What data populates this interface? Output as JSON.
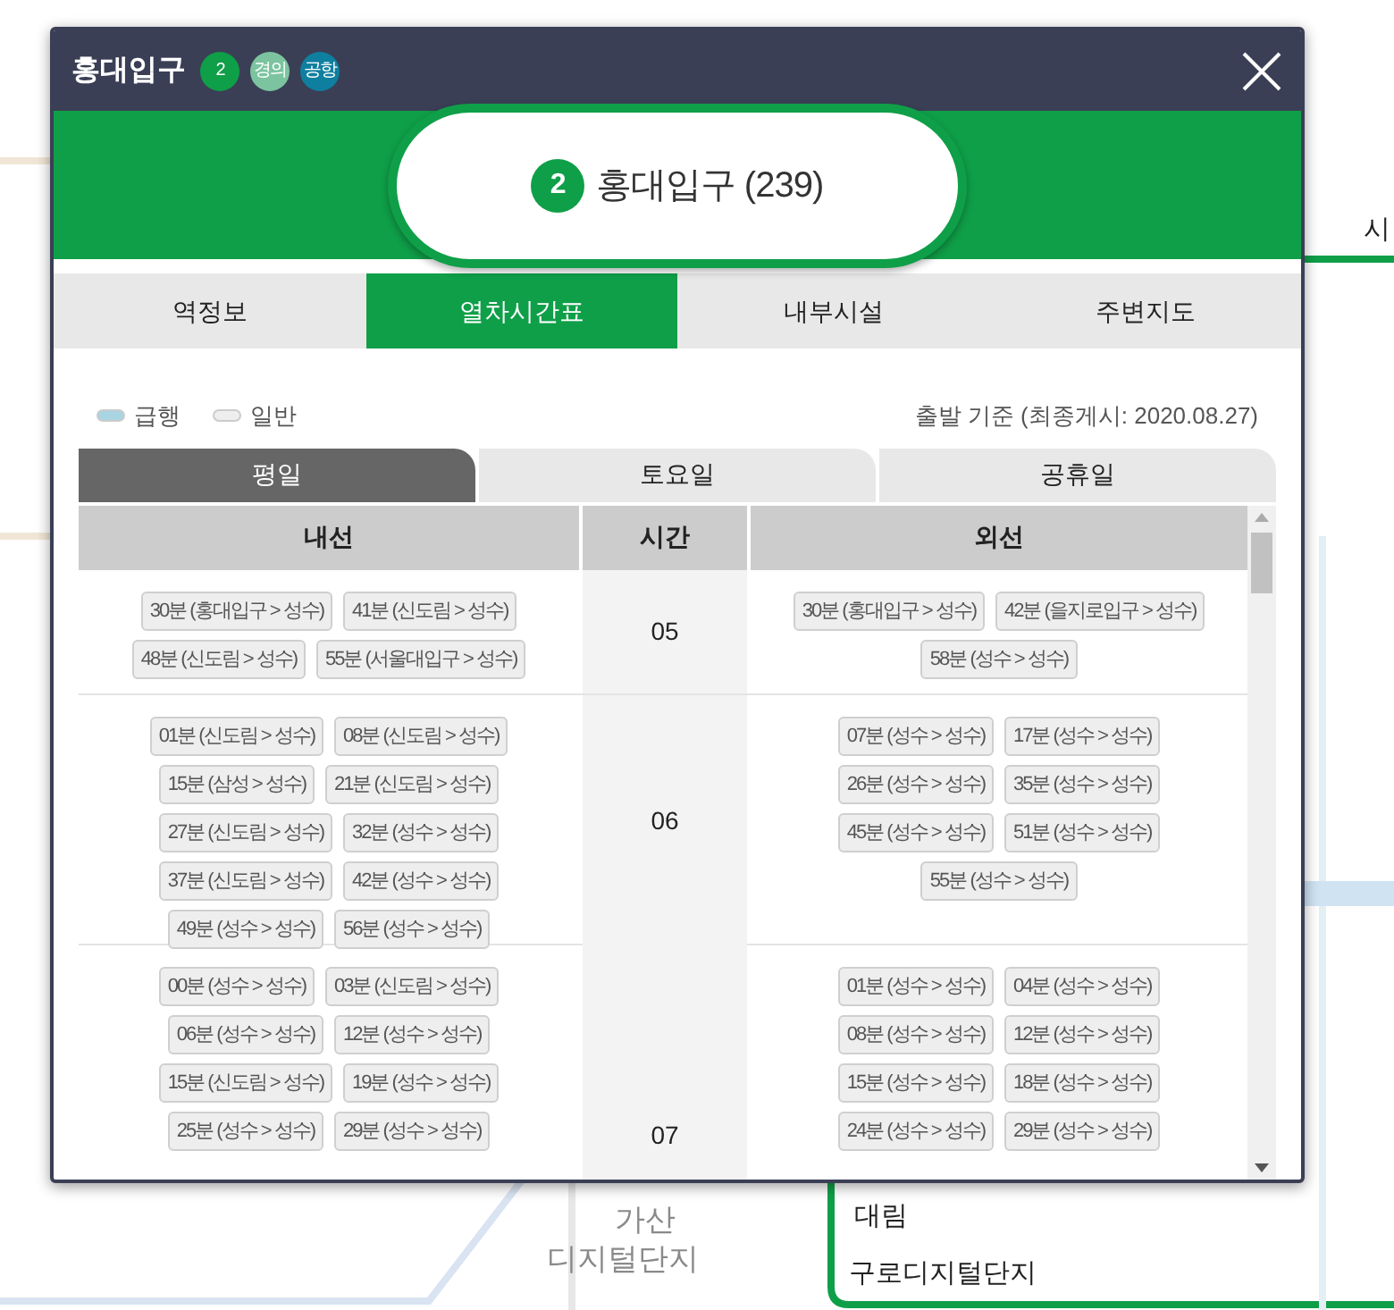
{
  "map_labels": [
    {
      "text": "시",
      "kind": "strong"
    },
    {
      "text": "가산",
      "kind": "faded"
    },
    {
      "text": "디지털단지",
      "kind": "faded"
    },
    {
      "text": "대림",
      "kind": "strong"
    },
    {
      "text": "구로디지털단지",
      "kind": "strong"
    }
  ],
  "window": {
    "title": "홍대입구",
    "line_badges": [
      {
        "text": "2",
        "color": "#0f9f48"
      },
      {
        "text": "경의",
        "color": "#7cc4a0"
      },
      {
        "text": "공항",
        "color": "#0f7fa0"
      }
    ]
  },
  "station": {
    "line": "2",
    "name": "홍대입구 (239)"
  },
  "tabs": [
    {
      "label": "역정보",
      "selected": false
    },
    {
      "label": "열차시간표",
      "selected": true
    },
    {
      "label": "내부시설",
      "selected": false
    },
    {
      "label": "주변지도",
      "selected": false
    }
  ],
  "legend": [
    {
      "label": "급행",
      "color": "#a9d4e2"
    },
    {
      "label": "일반",
      "color": "#eeeeee"
    }
  ],
  "basis": "출발 기준 (최종게시: 2020.08.27)",
  "day_tabs": [
    {
      "label": "평일",
      "selected": true
    },
    {
      "label": "토요일",
      "selected": false
    },
    {
      "label": "공휴일",
      "selected": false
    }
  ],
  "table": {
    "columns": [
      "내선",
      "시간",
      "외선"
    ],
    "rows": [
      {
        "hour": "05",
        "inner": [
          "30분 (홍대입구 > 성수)",
          "41분 (신도림 > 성수)",
          "48분 (신도림 > 성수)",
          "55분 (서울대입구 > 성수)"
        ],
        "outer": [
          "30분 (홍대입구 > 성수)",
          "42분 (을지로입구 > 성수)",
          "58분 (성수 > 성수)"
        ]
      },
      {
        "hour": "06",
        "inner": [
          "01분 (신도림 > 성수)",
          "08분 (신도림 > 성수)",
          "15분 (삼성 > 성수)",
          "21분 (신도림 > 성수)",
          "27분 (신도림 > 성수)",
          "32분 (성수 > 성수)",
          "37분 (신도림 > 성수)",
          "42분 (성수 > 성수)",
          "49분 (성수 > 성수)",
          "56분 (성수 > 성수)"
        ],
        "outer": [
          "07분 (성수 > 성수)",
          "17분 (성수 > 성수)",
          "26분 (성수 > 성수)",
          "35분 (성수 > 성수)",
          "45분 (성수 > 성수)",
          "51분 (성수 > 성수)",
          "55분 (성수 > 성수)"
        ]
      },
      {
        "hour": "07",
        "inner": [
          "00분 (성수 > 성수)",
          "03분 (신도림 > 성수)",
          "06분 (성수 > 성수)",
          "12분 (성수 > 성수)",
          "15분 (신도림 > 성수)",
          "19분 (성수 > 성수)",
          "25분 (성수 > 성수)",
          "29분 (성수 > 성수)"
        ],
        "outer": [
          "01분 (성수 > 성수)",
          "04분 (성수 > 성수)",
          "08분 (성수 > 성수)",
          "12분 (성수 > 성수)",
          "15분 (성수 > 성수)",
          "18분 (성수 > 성수)",
          "24분 (성수 > 성수)",
          "29분 (성수 > 성수)"
        ]
      }
    ]
  }
}
